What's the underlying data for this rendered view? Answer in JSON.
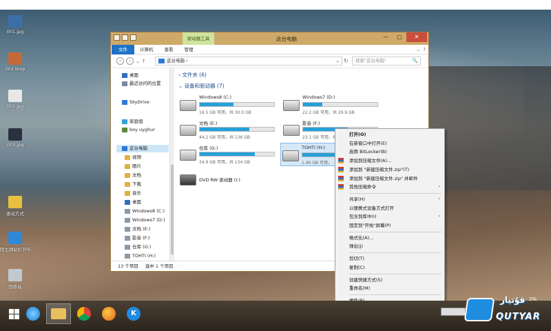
{
  "desktop_icons": [
    {
      "label": "001.jpg",
      "color": "#3a6fa8"
    },
    {
      "label": "002.bmp",
      "color": "#c46a3a"
    },
    {
      "label": "002.jpg",
      "color": "#e8e8e8"
    },
    {
      "label": "003.jpg",
      "color": "#2a3040"
    },
    {
      "label": "驱动方式",
      "color": "#e8c040"
    },
    {
      "label": "陌生网站打开IE",
      "color": "#2d8ad8"
    },
    {
      "label": "回收站",
      "color": "#c0c8d0"
    }
  ],
  "window": {
    "context_tab": "驱动器工具",
    "title": "这台电脑",
    "minimize": "—",
    "maximize": "□",
    "close": "✕",
    "ribbon_tabs": [
      "文件",
      "计算机",
      "查看",
      "管理"
    ],
    "ribbon_right": [
      "⌄",
      "?"
    ],
    "nav_back": "‹",
    "nav_forward": "›",
    "nav_recent": "⌄",
    "nav_up": "↑",
    "path": "这台电脑 ›",
    "path_dropdown": "⌄",
    "refresh": "↻",
    "search_placeholder": "搜索\"这台电脑\"",
    "search_icon": "🔍"
  },
  "nav_pane": [
    {
      "label": "桌面",
      "icon_color": "#2d6ec0"
    },
    {
      "label": "最近访问的位置",
      "icon_color": "#7a8aa0"
    },
    {
      "label": "SkyDrive",
      "icon_color": "#2d7ad6"
    },
    {
      "label": "家庭组",
      "icon_color": "#3aa0d8"
    },
    {
      "label": "boy uyghur",
      "icon_color": "#5c8a3a"
    },
    {
      "label": "这台电脑",
      "icon_color": "#2d7ad6",
      "selected": true
    },
    {
      "label": "视频",
      "icon_color": "#e0b040"
    },
    {
      "label": "图片",
      "icon_color": "#e0b040"
    },
    {
      "label": "文档",
      "icon_color": "#e0b040"
    },
    {
      "label": "下载",
      "icon_color": "#e0b040"
    },
    {
      "label": "音乐",
      "icon_color": "#e0b040"
    },
    {
      "label": "桌面",
      "icon_color": "#2d6ec0"
    },
    {
      "label": "Windows8 (C:)",
      "icon_color": "#8a9aaa"
    },
    {
      "label": "Windows7 (D:)",
      "icon_color": "#8a9aaa"
    },
    {
      "label": "文档 (E:)",
      "icon_color": "#8a9aaa"
    },
    {
      "label": "影音 (F:)",
      "icon_color": "#8a9aaa"
    },
    {
      "label": "仓库 (G:)",
      "icon_color": "#8a9aaa"
    },
    {
      "label": "TOHTI (H:)",
      "icon_color": "#8a9aaa"
    }
  ],
  "content": {
    "folders_header": "文件夹 (6)",
    "devices_header": "设备和驱动器 (7)",
    "drives": [
      {
        "name": "Windows8 (C:)",
        "free": "16.5 GB 可用，共 30.0 GB",
        "used_fraction": 0.45,
        "selected": false
      },
      {
        "name": "Windows7 (D:)",
        "free": "22.2 GB 可用，共 29.9 GB",
        "used_fraction": 0.26,
        "selected": false
      },
      {
        "name": "文档 (E:)",
        "free": "44.2 GB 可用，共 136 GB",
        "used_fraction": 0.67,
        "selected": false
      },
      {
        "name": "影音 (F:)",
        "free": "23.1 GB 可用，共",
        "used_fraction": 0.6,
        "selected": false
      },
      {
        "name": "仓库 (G:)",
        "free": "34.9 GB 可用，共 134 GB",
        "used_fraction": 0.74,
        "selected": false
      },
      {
        "name": "TOHTI (H:)",
        "free": "1.40 GB 可用，",
        "used_fraction": 0.7,
        "selected": true
      },
      {
        "name": "DVD RW 驱动器 (I:)",
        "free": "",
        "used_fraction": null,
        "selected": false
      }
    ]
  },
  "status": {
    "count": "13 个项目",
    "selected": "选中 1 个项目"
  },
  "context_menu": [
    {
      "label": "打开(O)",
      "bold": true
    },
    {
      "label": "在新窗口中打开(E)"
    },
    {
      "label": "启用 BitLocker(B)"
    },
    {
      "label": "添加到压缩文件(A)...",
      "icon": true
    },
    {
      "label": "添加到 \"新建压缩文件.zip\"(T)",
      "icon": true
    },
    {
      "label": "添加到 \"新建压缩文件.zip\" 并邮件",
      "icon": true
    },
    {
      "label": "其他压缩命令",
      "icon": true,
      "submenu": true
    },
    {
      "sep": true
    },
    {
      "label": "共享(H)",
      "submenu": true
    },
    {
      "label": "以便携式设备方式打开"
    },
    {
      "label": "包含到库中(I)",
      "submenu": true
    },
    {
      "label": "固定到\"开始\"屏幕(P)"
    },
    {
      "sep": true
    },
    {
      "label": "格式化(A)..."
    },
    {
      "label": "弹出(J)"
    },
    {
      "sep": true
    },
    {
      "label": "剪切(T)"
    },
    {
      "label": "复制(C)"
    },
    {
      "sep": true
    },
    {
      "label": "创建快捷方式(S)"
    },
    {
      "label": "重命名(M)"
    },
    {
      "sep": true
    },
    {
      "label": "属性(R)"
    }
  ],
  "context_menu_arrow": "›",
  "taskbar": {
    "apps": [
      "start",
      "ie",
      "explorer",
      "chrome",
      "firefox",
      "kugou"
    ],
    "tray_percent": "2%"
  },
  "watermark": {
    "text": "QUTYAR",
    "script": "قۇتيار"
  }
}
